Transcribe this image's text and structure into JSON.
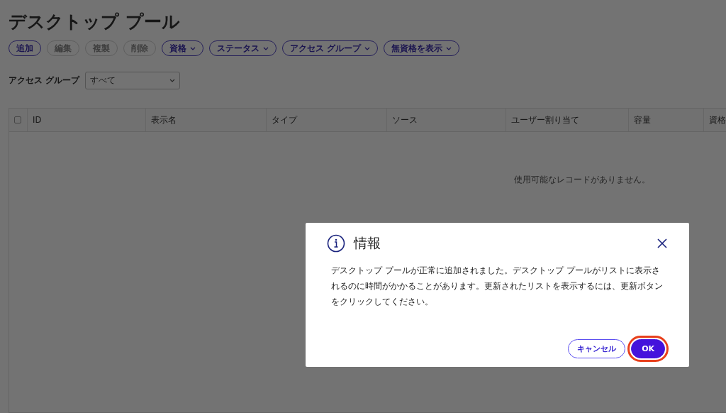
{
  "page": {
    "title": "デスクトップ プール"
  },
  "toolbar": [
    {
      "label": "追加",
      "kind": "action",
      "disabled": false
    },
    {
      "label": "編集",
      "kind": "action",
      "disabled": true
    },
    {
      "label": "複製",
      "kind": "action",
      "disabled": true
    },
    {
      "label": "削除",
      "kind": "action",
      "disabled": true
    },
    {
      "label": "資格",
      "kind": "menu",
      "disabled": false
    },
    {
      "label": "ステータス",
      "kind": "menu",
      "disabled": false
    },
    {
      "label": "アクセス グループ",
      "kind": "menu",
      "disabled": false
    },
    {
      "label": "無資格を表示",
      "kind": "menu",
      "disabled": false
    }
  ],
  "filter": {
    "label": "アクセス グループ",
    "value": "すべて"
  },
  "table": {
    "select_all": {
      "checked": false
    },
    "columns": [
      "ID",
      "表示名",
      "タイプ",
      "ソース",
      "ユーザー割り当て",
      "容量",
      "資格"
    ],
    "empty_message": "使用可能なレコードがありません。"
  },
  "dialog": {
    "title": "情報",
    "message": "デスクトップ プールが正常に追加されました。デスクトップ プールがリストに表示されるのに時間がかかることがあります。更新されたリストを表示するには、更新ボタンをクリックしてください。",
    "buttons": [
      {
        "label": "キャンセル",
        "kind": "secondary",
        "highlighted": false
      },
      {
        "label": "OK",
        "kind": "primary",
        "highlighted": true
      }
    ]
  }
}
